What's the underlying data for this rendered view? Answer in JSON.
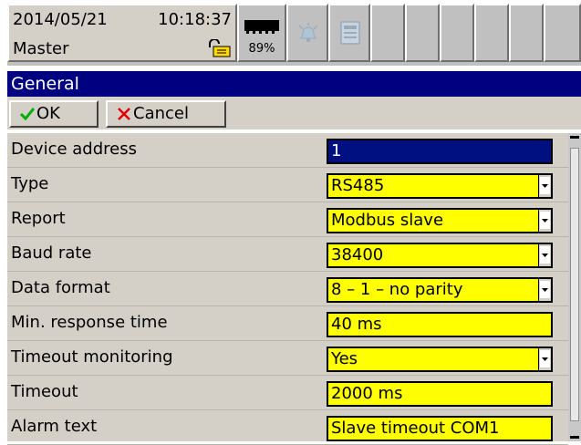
{
  "status": {
    "date": "2014/05/21",
    "time": "10:18:37",
    "user": "Master",
    "memory_percent": "89%"
  },
  "icons": {
    "lock": "lock-icon",
    "memory": "memory-chip-icon",
    "alarm": "alarm-bell-icon",
    "event": "event-list-icon"
  },
  "title": "General",
  "buttons": {
    "ok": "OK",
    "cancel": "Cancel"
  },
  "settings": [
    {
      "label": "Device address",
      "value": "1",
      "dropdown": false
    },
    {
      "label": "Type",
      "value": "RS485",
      "dropdown": true
    },
    {
      "label": "Report",
      "value": "Modbus slave",
      "dropdown": true
    },
    {
      "label": "Baud rate",
      "value": "38400",
      "dropdown": true
    },
    {
      "label": "Data format",
      "value": "8 – 1 – no parity",
      "dropdown": true
    },
    {
      "label": "Min. response time",
      "value": "40 ms",
      "dropdown": false
    },
    {
      "label": "Timeout monitoring",
      "value": "Yes",
      "dropdown": true
    },
    {
      "label": "Timeout",
      "value": "2000 ms",
      "dropdown": false
    },
    {
      "label": "Alarm text",
      "value": "Slave timeout COM1",
      "dropdown": false
    }
  ],
  "colors": {
    "title_bar": "#000080",
    "field_background": "#ffff00",
    "selected_field": "#001080",
    "panel": "#d4d0c8"
  }
}
